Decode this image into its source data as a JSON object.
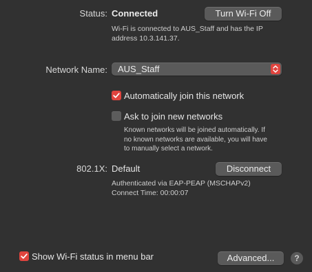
{
  "status": {
    "label": "Status:",
    "value": "Connected",
    "toggle_button": "Turn Wi-Fi Off",
    "description_line1": "Wi-Fi is connected to AUS_Staff and has the IP",
    "description_line2": "address 10.3.141.37."
  },
  "network": {
    "label": "Network Name:",
    "selected": "AUS_Staff"
  },
  "options": {
    "auto_join": {
      "label": "Automatically join this network",
      "checked": true
    },
    "ask_join": {
      "label": "Ask to join new networks",
      "checked": false
    },
    "note_line1": "Known networks will be joined automatically. If",
    "note_line2": "no known networks are available, you will have",
    "note_line3": "to manually select a network."
  },
  "dot1x": {
    "label": "802.1X:",
    "value": "Default",
    "disconnect_button": "Disconnect",
    "auth_line": "Authenticated via EAP-PEAP (MSCHAPv2)",
    "connect_time": "Connect Time: 00:00:07"
  },
  "footer": {
    "show_status": {
      "label": "Show Wi-Fi status in menu bar",
      "checked": true
    },
    "advanced_button": "Advanced...",
    "help_icon": "?"
  },
  "colors": {
    "background": "#313131",
    "accent": "#e0443e",
    "button": "#5a5a5a"
  },
  "icons": {
    "popup_arrows": "chevron-up-down-icon",
    "checkmark": "checkmark-icon",
    "help": "question-mark-icon"
  }
}
